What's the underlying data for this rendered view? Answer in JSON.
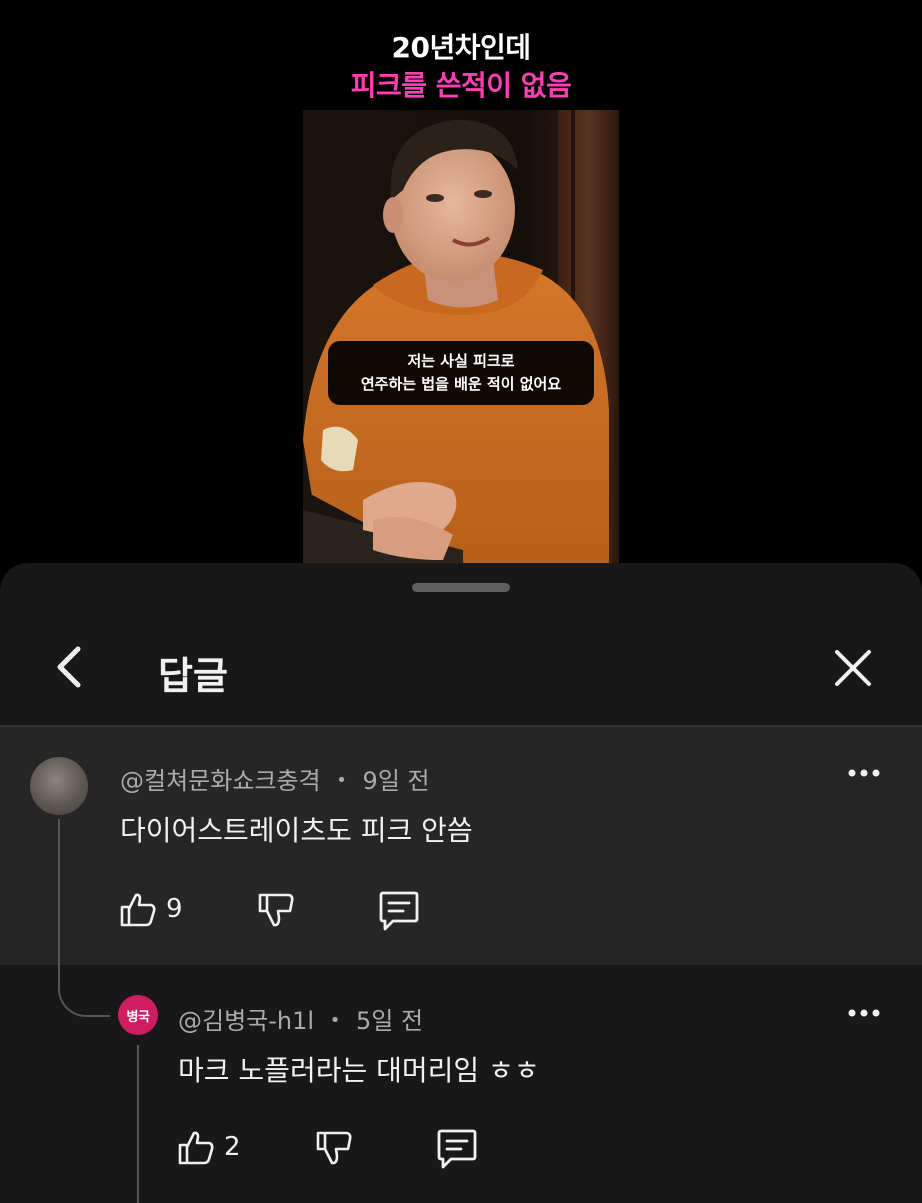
{
  "video": {
    "caption_line1": "20년차인데",
    "caption_line2": "피크를 쓴적이 없음",
    "subtitle_line1": "저는 사실 피크로",
    "subtitle_line2": "연주하는 법을 배운 적이 없어요",
    "colors": {
      "caption_accent": "#ff3fb4"
    }
  },
  "sheet": {
    "title": "답글"
  },
  "parent_comment": {
    "author": "@컬쳐문화쇼크충격",
    "time": "9일 전",
    "text": "다이어스트레이츠도 피크 안씀",
    "likes": "9"
  },
  "reply_comment": {
    "avatar_text": "병국",
    "author": "@김병국-h1l",
    "time": "5일 전",
    "text": "마크 노플러라는 대머리임 ㅎㅎ",
    "likes": "2",
    "colors": {
      "avatar_bg": "#cd1e62"
    }
  },
  "icons": {
    "back": "chevron-left-icon",
    "close": "close-icon",
    "more": "more-dots-icon",
    "like": "thumbs-up-icon",
    "dislike": "thumbs-down-icon",
    "reply": "reply-comment-icon"
  },
  "separator": "•"
}
